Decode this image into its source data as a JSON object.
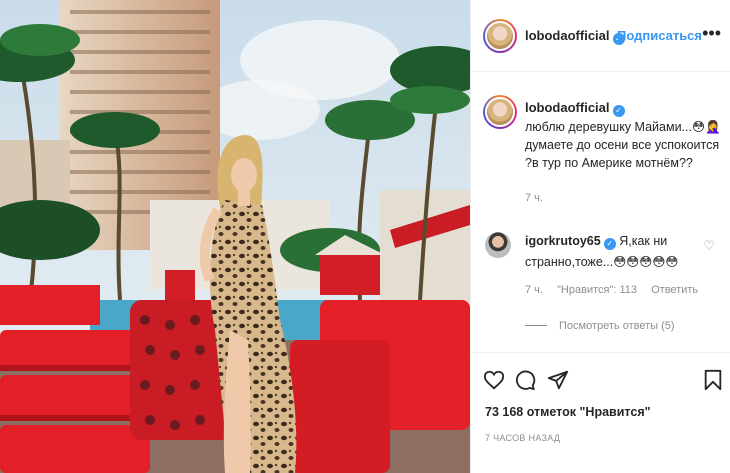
{
  "post": {
    "username": "lobodaofficial",
    "verified_mark": "✓",
    "follow_label": "Подписаться",
    "more_label": "•••",
    "caption_line1": "люблю деревушку Майами...",
    "caption_emoji": "😳🤦‍♀️",
    "caption_line2": "думаете до осени все успокоится ?в тур по Америке мотнём??",
    "caption_time": "7 ч."
  },
  "comment": {
    "username": "igorkrutoy65",
    "verified_mark": "✓",
    "text1": "Я,как ни",
    "text2": "странно,тоже...😳😳😳😳😳",
    "time": "7 ч.",
    "likes": "\"Нравится\": 113",
    "reply_label": "Ответить",
    "view_replies": "Посмотреть ответы (5)",
    "heart_icon": "♡"
  },
  "actions": {
    "likes_count": "73 168 отметок \"Нравится\"",
    "posted_ago": "7 ЧАСОВ НАЗАД"
  },
  "icons": [
    "heart-icon",
    "comment-icon",
    "share-icon",
    "bookmark-icon",
    "more-icon",
    "verified-icon"
  ],
  "colors": {
    "accent": "#3897f0",
    "text": "#262626",
    "muted": "#8e8e8e",
    "border": "#efefef"
  }
}
